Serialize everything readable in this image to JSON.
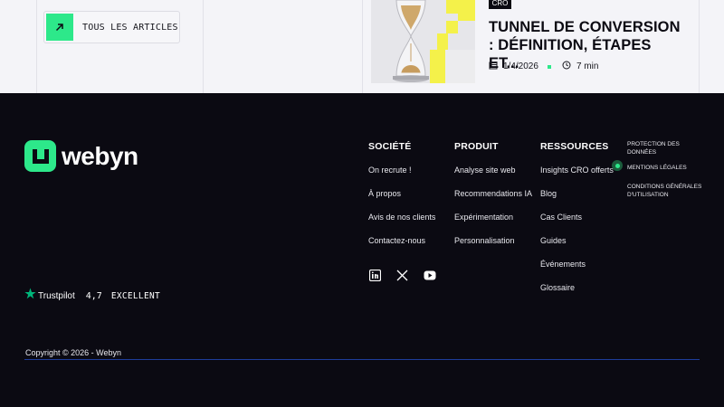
{
  "top": {
    "all_articles_label": "TOUS LES ARTICLES",
    "article": {
      "tag": "CRO",
      "title": "TUNNEL DE CONVERSION : DÉFINITION, ÉTAPES ET...",
      "date": "1/4/2026",
      "read_time": "7 min"
    }
  },
  "footer": {
    "logo_text": "webyn",
    "columns": {
      "societe": {
        "heading": "SOCIÉTÉ",
        "links": [
          "On recrute !",
          "À propos",
          "Avis de nos clients",
          "Contactez-nous"
        ]
      },
      "produit": {
        "heading": "PRODUIT",
        "links": [
          "Analyse site web",
          "Recommendations IA",
          "Expérimentation",
          "Personnalisation"
        ]
      },
      "ressources": {
        "heading": "RESSOURCES",
        "links": [
          "Insights CRO offerts",
          "Blog",
          "Cas Clients",
          "Guides",
          "Événements",
          "Glossaire"
        ]
      }
    },
    "legal_links": [
      "PROTECTION DES DONNÉES",
      "MENTIONS LÉGALES",
      "CONDITIONS GÉNÉRALES D'UTILISATION"
    ],
    "socials": [
      "linkedin-icon",
      "x-icon",
      "youtube-icon"
    ],
    "trustpilot": {
      "brand": "Trustpilot",
      "rating": "4,7",
      "label": "EXCELLENT"
    },
    "copyright": "Copyright © 2026 - Webyn"
  },
  "colors": {
    "accent": "#2de88a",
    "footer_bg": "#0b0a12",
    "top_bg": "#f4f4f8"
  }
}
